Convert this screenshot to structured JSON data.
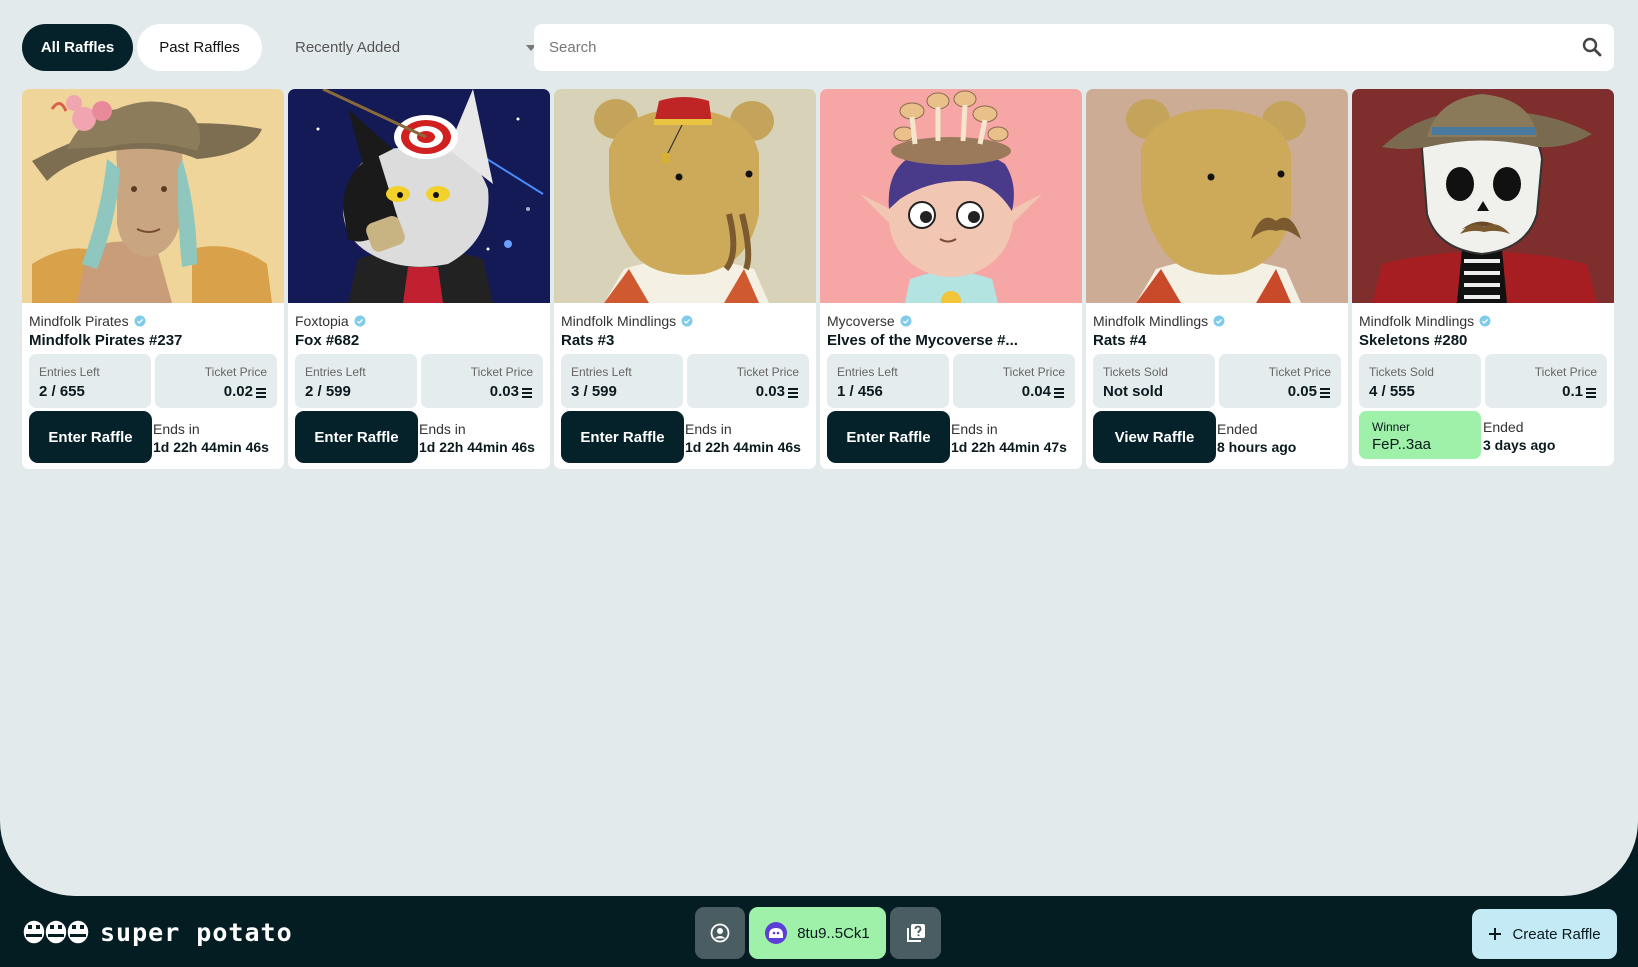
{
  "tabs": {
    "all": "All Raffles",
    "past": "Past Raffles"
  },
  "sort": {
    "selected": "Recently Added"
  },
  "search": {
    "placeholder": "Search"
  },
  "cards": [
    {
      "collection": "Mindfolk Pirates",
      "name": "Mindfolk Pirates #237",
      "stat1_label": "Entries Left",
      "stat1_value": "2 / 655",
      "price_label": "Ticket Price",
      "price": "0.02",
      "button": "Enter Raffle",
      "end_label": "Ends in",
      "end_value": "1d 22h 44min 46s"
    },
    {
      "collection": "Foxtopia",
      "name": "Fox #682",
      "stat1_label": "Entries Left",
      "stat1_value": "2 / 599",
      "price_label": "Ticket Price",
      "price": "0.03",
      "button": "Enter Raffle",
      "end_label": "Ends in",
      "end_value": "1d 22h 44min 46s"
    },
    {
      "collection": "Mindfolk Mindlings",
      "name": "Rats #3",
      "stat1_label": "Entries Left",
      "stat1_value": "3 / 599",
      "price_label": "Ticket Price",
      "price": "0.03",
      "button": "Enter Raffle",
      "end_label": "Ends in",
      "end_value": "1d 22h 44min 46s"
    },
    {
      "collection": "Mycoverse",
      "name": "Elves of the Mycoverse #...",
      "stat1_label": "Entries Left",
      "stat1_value": "1 / 456",
      "price_label": "Ticket Price",
      "price": "0.04",
      "button": "Enter Raffle",
      "end_label": "Ends in",
      "end_value": "1d 22h 44min 47s"
    },
    {
      "collection": "Mindfolk Mindlings",
      "name": "Rats #4",
      "stat1_label": "Tickets Sold",
      "stat1_value": "Not sold",
      "price_label": "Ticket Price",
      "price": "0.05",
      "button": "View Raffle",
      "end_label": "Ended",
      "end_value": "8 hours ago"
    },
    {
      "collection": "Mindfolk Mindlings",
      "name": "Skeletons #280",
      "stat1_label": "Tickets Sold",
      "stat1_value": "4 / 555",
      "price_label": "Ticket Price",
      "price": "0.1",
      "winner_label": "Winner",
      "winner_value": "FeP..3aa",
      "end_label": "Ended",
      "end_value": "3 days ago"
    }
  ],
  "footer": {
    "logo_text": "super potato",
    "wallet": "8tu9..5Ck1",
    "create": "Create Raffle"
  },
  "colors": {
    "dark": "#05222a",
    "background": "#e2eaec",
    "winner": "#9ff0a8",
    "create": "#c4eaf5",
    "verified": "#7fcbea"
  },
  "icons": [
    "search-icon",
    "verified-icon",
    "sol-icon",
    "profile-icon",
    "wallet-avatar-icon",
    "help-icon",
    "plus-icon"
  ]
}
